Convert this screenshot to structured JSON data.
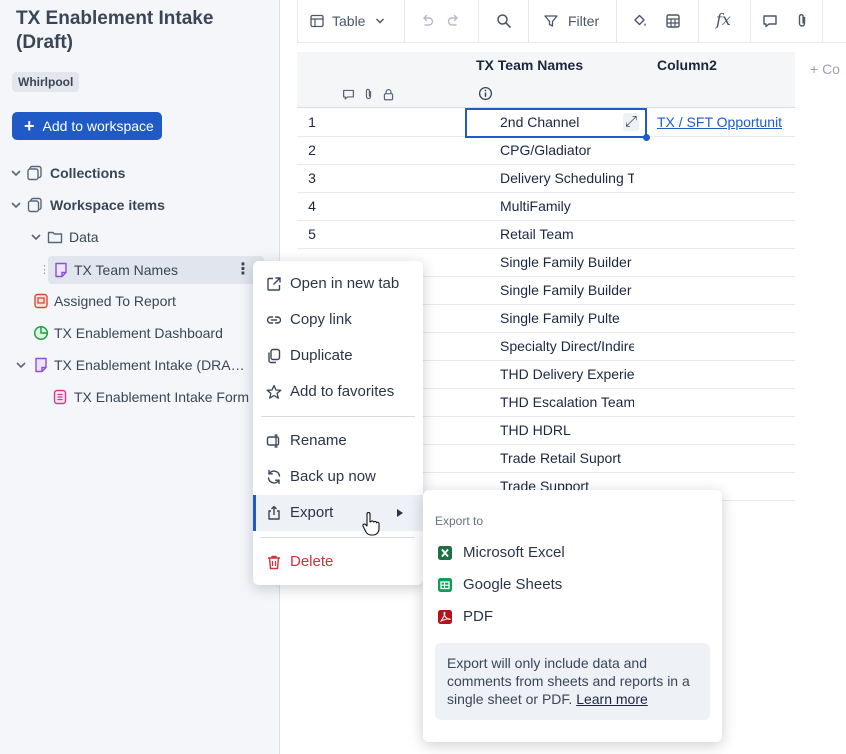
{
  "sidebar": {
    "title": "TX Enablement Intake (Draft)",
    "workspace_badge": "Whirlpool",
    "add_button": "Add to workspace",
    "tree": {
      "collections": "Collections",
      "workspace_items": "Workspace items",
      "data_folder": "Data",
      "tx_team_names": "TX Team Names",
      "assigned_report": "Assigned To Report",
      "dashboard": "TX Enablement Dashboard",
      "intake_draft": "TX Enablement Intake (DRAFT)",
      "intake_form": "TX Enablement Intake Form"
    }
  },
  "toolbar": {
    "view_label": "Table",
    "filter_label": "Filter"
  },
  "grid": {
    "columns": [
      "TX Team Names",
      "Column2"
    ],
    "add_column": "+ Co",
    "rows": [
      {
        "num": "1",
        "name": "2nd Channel",
        "col2": "TX / SFT Opportunit"
      },
      {
        "num": "2",
        "name": "CPG/Gladiator",
        "col2": ""
      },
      {
        "num": "3",
        "name": "Delivery Scheduling T",
        "col2": ""
      },
      {
        "num": "4",
        "name": "MultiFamily",
        "col2": ""
      },
      {
        "num": "5",
        "name": "Retail Team",
        "col2": ""
      },
      {
        "num": "",
        "name": "Single Family Builder",
        "col2": ""
      },
      {
        "num": "",
        "name": "Single Family Builder",
        "col2": ""
      },
      {
        "num": "",
        "name": "Single Family Pulte",
        "col2": ""
      },
      {
        "num": "",
        "name": "Specialty Direct/Indire",
        "col2": ""
      },
      {
        "num": "",
        "name": "THD Delivery Experie",
        "col2": ""
      },
      {
        "num": "",
        "name": "THD Escalation Team",
        "col2": ""
      },
      {
        "num": "",
        "name": "THD HDRL",
        "col2": ""
      },
      {
        "num": "",
        "name": "Trade Retail Suport",
        "col2": ""
      },
      {
        "num": "",
        "name": "Trade Support",
        "col2": ""
      }
    ]
  },
  "context_menu": {
    "open_new_tab": "Open in new tab",
    "copy_link": "Copy link",
    "duplicate": "Duplicate",
    "add_favorites": "Add to favorites",
    "rename": "Rename",
    "back_up": "Back up now",
    "export": "Export",
    "delete": "Delete"
  },
  "export_submenu": {
    "heading": "Export to",
    "excel": "Microsoft Excel",
    "sheets": "Google Sheets",
    "pdf": "PDF",
    "note": "Export will only include data and comments from sheets and reports in a single sheet or PDF.",
    "learn_more": "Learn more"
  },
  "colors": {
    "accent": "#1f5ac6",
    "delete": "#d1313d",
    "excel": "#1e7145",
    "sheets": "#0f9d58",
    "pdf": "#b3141c"
  }
}
